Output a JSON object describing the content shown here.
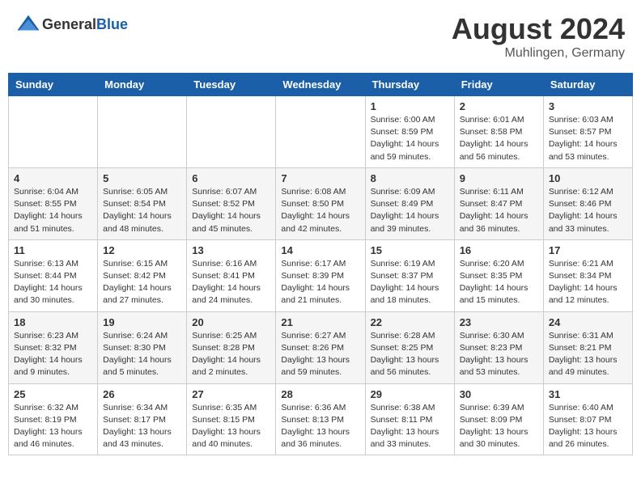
{
  "header": {
    "logo_general": "General",
    "logo_blue": "Blue",
    "main_title": "August 2024",
    "subtitle": "Muhlingen, Germany"
  },
  "calendar": {
    "days_of_week": [
      "Sunday",
      "Monday",
      "Tuesday",
      "Wednesday",
      "Thursday",
      "Friday",
      "Saturday"
    ],
    "weeks": [
      [
        {
          "day": "",
          "info": ""
        },
        {
          "day": "",
          "info": ""
        },
        {
          "day": "",
          "info": ""
        },
        {
          "day": "",
          "info": ""
        },
        {
          "day": "1",
          "info": "Sunrise: 6:00 AM\nSunset: 8:59 PM\nDaylight: 14 hours\nand 59 minutes."
        },
        {
          "day": "2",
          "info": "Sunrise: 6:01 AM\nSunset: 8:58 PM\nDaylight: 14 hours\nand 56 minutes."
        },
        {
          "day": "3",
          "info": "Sunrise: 6:03 AM\nSunset: 8:57 PM\nDaylight: 14 hours\nand 53 minutes."
        }
      ],
      [
        {
          "day": "4",
          "info": "Sunrise: 6:04 AM\nSunset: 8:55 PM\nDaylight: 14 hours\nand 51 minutes."
        },
        {
          "day": "5",
          "info": "Sunrise: 6:05 AM\nSunset: 8:54 PM\nDaylight: 14 hours\nand 48 minutes."
        },
        {
          "day": "6",
          "info": "Sunrise: 6:07 AM\nSunset: 8:52 PM\nDaylight: 14 hours\nand 45 minutes."
        },
        {
          "day": "7",
          "info": "Sunrise: 6:08 AM\nSunset: 8:50 PM\nDaylight: 14 hours\nand 42 minutes."
        },
        {
          "day": "8",
          "info": "Sunrise: 6:09 AM\nSunset: 8:49 PM\nDaylight: 14 hours\nand 39 minutes."
        },
        {
          "day": "9",
          "info": "Sunrise: 6:11 AM\nSunset: 8:47 PM\nDaylight: 14 hours\nand 36 minutes."
        },
        {
          "day": "10",
          "info": "Sunrise: 6:12 AM\nSunset: 8:46 PM\nDaylight: 14 hours\nand 33 minutes."
        }
      ],
      [
        {
          "day": "11",
          "info": "Sunrise: 6:13 AM\nSunset: 8:44 PM\nDaylight: 14 hours\nand 30 minutes."
        },
        {
          "day": "12",
          "info": "Sunrise: 6:15 AM\nSunset: 8:42 PM\nDaylight: 14 hours\nand 27 minutes."
        },
        {
          "day": "13",
          "info": "Sunrise: 6:16 AM\nSunset: 8:41 PM\nDaylight: 14 hours\nand 24 minutes."
        },
        {
          "day": "14",
          "info": "Sunrise: 6:17 AM\nSunset: 8:39 PM\nDaylight: 14 hours\nand 21 minutes."
        },
        {
          "day": "15",
          "info": "Sunrise: 6:19 AM\nSunset: 8:37 PM\nDaylight: 14 hours\nand 18 minutes."
        },
        {
          "day": "16",
          "info": "Sunrise: 6:20 AM\nSunset: 8:35 PM\nDaylight: 14 hours\nand 15 minutes."
        },
        {
          "day": "17",
          "info": "Sunrise: 6:21 AM\nSunset: 8:34 PM\nDaylight: 14 hours\nand 12 minutes."
        }
      ],
      [
        {
          "day": "18",
          "info": "Sunrise: 6:23 AM\nSunset: 8:32 PM\nDaylight: 14 hours\nand 9 minutes."
        },
        {
          "day": "19",
          "info": "Sunrise: 6:24 AM\nSunset: 8:30 PM\nDaylight: 14 hours\nand 5 minutes."
        },
        {
          "day": "20",
          "info": "Sunrise: 6:25 AM\nSunset: 8:28 PM\nDaylight: 14 hours\nand 2 minutes."
        },
        {
          "day": "21",
          "info": "Sunrise: 6:27 AM\nSunset: 8:26 PM\nDaylight: 13 hours\nand 59 minutes."
        },
        {
          "day": "22",
          "info": "Sunrise: 6:28 AM\nSunset: 8:25 PM\nDaylight: 13 hours\nand 56 minutes."
        },
        {
          "day": "23",
          "info": "Sunrise: 6:30 AM\nSunset: 8:23 PM\nDaylight: 13 hours\nand 53 minutes."
        },
        {
          "day": "24",
          "info": "Sunrise: 6:31 AM\nSunset: 8:21 PM\nDaylight: 13 hours\nand 49 minutes."
        }
      ],
      [
        {
          "day": "25",
          "info": "Sunrise: 6:32 AM\nSunset: 8:19 PM\nDaylight: 13 hours\nand 46 minutes."
        },
        {
          "day": "26",
          "info": "Sunrise: 6:34 AM\nSunset: 8:17 PM\nDaylight: 13 hours\nand 43 minutes."
        },
        {
          "day": "27",
          "info": "Sunrise: 6:35 AM\nSunset: 8:15 PM\nDaylight: 13 hours\nand 40 minutes."
        },
        {
          "day": "28",
          "info": "Sunrise: 6:36 AM\nSunset: 8:13 PM\nDaylight: 13 hours\nand 36 minutes."
        },
        {
          "day": "29",
          "info": "Sunrise: 6:38 AM\nSunset: 8:11 PM\nDaylight: 13 hours\nand 33 minutes."
        },
        {
          "day": "30",
          "info": "Sunrise: 6:39 AM\nSunset: 8:09 PM\nDaylight: 13 hours\nand 30 minutes."
        },
        {
          "day": "31",
          "info": "Sunrise: 6:40 AM\nSunset: 8:07 PM\nDaylight: 13 hours\nand 26 minutes."
        }
      ]
    ]
  }
}
